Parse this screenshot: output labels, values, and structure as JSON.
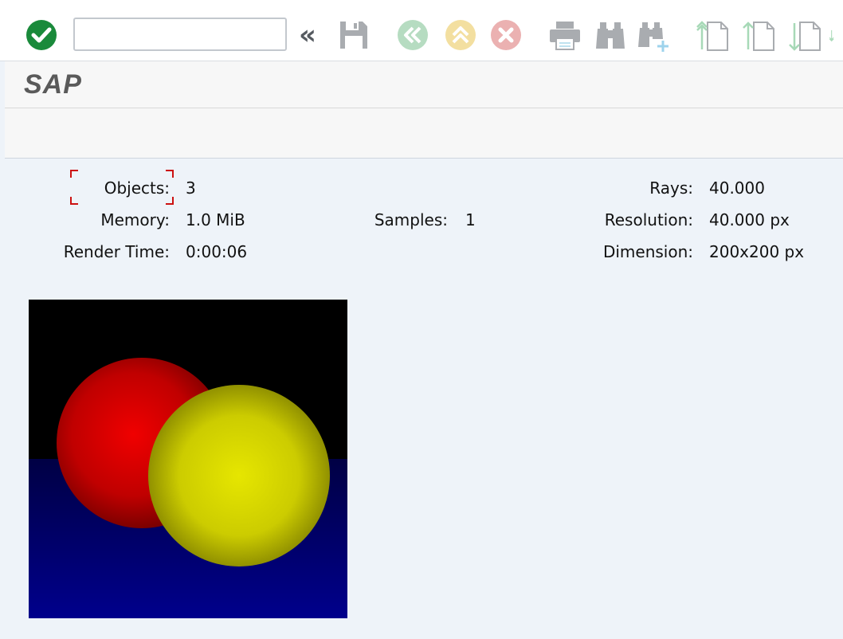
{
  "toolbar": {
    "command_field": {
      "value": "",
      "placeholder": ""
    },
    "collapse_label": "«",
    "buttons": [
      {
        "name": "enter",
        "icon": "checkmark-icon",
        "color": "#1a8a3b",
        "enabled": true
      },
      {
        "name": "save",
        "icon": "save-icon",
        "enabled": false
      },
      {
        "name": "back",
        "icon": "back-icon",
        "color": "#b6dcc1",
        "enabled": false
      },
      {
        "name": "exit",
        "icon": "exit-icon",
        "color": "#f3dfa0",
        "enabled": false
      },
      {
        "name": "cancel",
        "icon": "cancel-icon",
        "color": "#ebb1b1",
        "enabled": false
      },
      {
        "name": "print",
        "icon": "print-icon",
        "enabled": false
      },
      {
        "name": "find",
        "icon": "binoculars-icon",
        "enabled": false
      },
      {
        "name": "find-next",
        "icon": "binoculars-plus-icon",
        "enabled": false
      },
      {
        "name": "first-page",
        "icon": "page-up-double-icon",
        "enabled": false
      },
      {
        "name": "previous-page",
        "icon": "page-up-icon",
        "enabled": false
      },
      {
        "name": "next-page",
        "icon": "page-down-icon",
        "enabled": false
      },
      {
        "name": "last-page",
        "icon": "page-down-double-icon",
        "enabled": false
      }
    ]
  },
  "title": "SAP",
  "stats": {
    "objects": {
      "label": "Objects:",
      "value": "3"
    },
    "memory": {
      "label": "Memory:",
      "value": "1.0 MiB"
    },
    "render_time": {
      "label": "Render Time:",
      "value": "0:00:06"
    },
    "samples": {
      "label": "Samples:",
      "value": "1"
    },
    "rays": {
      "label": "Rays:",
      "value": "40.000"
    },
    "resolution": {
      "label": "Resolution:",
      "value": "40.000 px"
    },
    "dimension": {
      "label": "Dimension:",
      "value": "200x200 px"
    }
  },
  "render_image": {
    "sky_color": "#000000",
    "floor_color": "#00007a",
    "spheres": [
      {
        "name": "red-sphere",
        "color": "#e00000"
      },
      {
        "name": "yellow-sphere",
        "color": "#e4e400"
      }
    ]
  },
  "colors": {
    "icon_disabled": "#a9acb0",
    "icon_nav_disabled": "#a7d9b7",
    "content_bg": "#eef3f9",
    "focus_marker": "#cc1111"
  }
}
